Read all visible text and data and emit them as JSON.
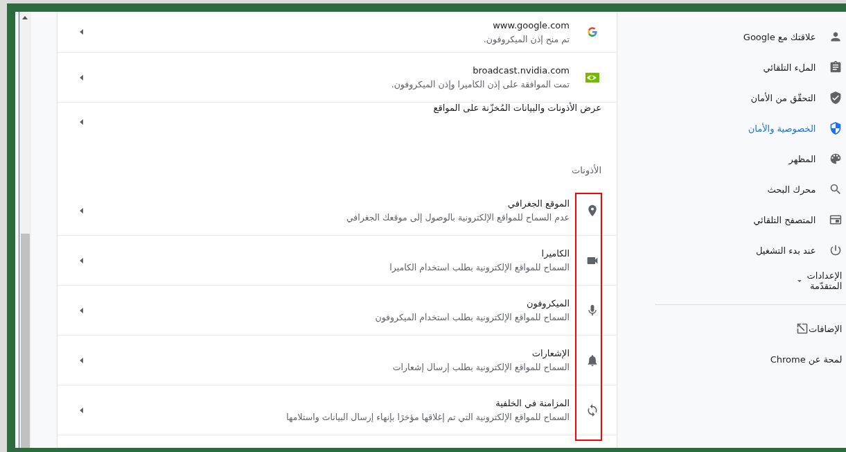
{
  "sites": [
    {
      "domain": "www.google.com",
      "status": "تم منح إذن الميكروفون.",
      "kind": "google"
    },
    {
      "domain": "broadcast.nvidia.com",
      "status": "تمت الموافقة على إذن الكاميرا وإذن الميكروفون.",
      "kind": "nvidia"
    }
  ],
  "view_all_link": "عرض الأذونات والبيانات المُخزّنة على المواقع",
  "permissions_heading": "الأذونات",
  "permissions": [
    {
      "title": "الموقع الجغرافي",
      "description": "عدم السماح للمواقع الإلكترونية بالوصول إلى موقعك الجغرافي",
      "kind": "location"
    },
    {
      "title": "الكاميرا",
      "description": "السماح للمواقع الإلكترونية بطلب استخدام الكاميرا",
      "kind": "camera"
    },
    {
      "title": "الميكروفون",
      "description": "السماح للمواقع الإلكترونية بطلب استخدام الميكروفون",
      "kind": "mic"
    },
    {
      "title": "الإشعارات",
      "description": "السماح للمواقع الإلكترونية بطلب إرسال إشعارات",
      "kind": "bell"
    },
    {
      "title": "المزامنة في الخلفية",
      "description": "السماح للمواقع الإلكترونية التي تم إغلاقها مؤخرًا بإنهاء إرسال البيانات واستلامها",
      "kind": "sync"
    }
  ],
  "sidebar": {
    "items": [
      {
        "label": "علاقتك مع Google",
        "kind": "person",
        "selected": false
      },
      {
        "label": "الملء التلقائي",
        "kind": "clipboard",
        "selected": false
      },
      {
        "label": "التحقّق من الأمان",
        "kind": "shield-check",
        "selected": false
      },
      {
        "label": "الخصوصية والأمان",
        "kind": "shield",
        "selected": true
      },
      {
        "label": "المظهر",
        "kind": "palette",
        "selected": false
      },
      {
        "label": "محرك البحث",
        "kind": "search",
        "selected": false
      },
      {
        "label": "المتصفح التلقائي",
        "kind": "browser",
        "selected": false
      },
      {
        "label": "عند بدء التشغيل",
        "kind": "power",
        "selected": false
      }
    ],
    "advanced": {
      "label": "الإعدادات المتقدّمة",
      "expanded": false
    },
    "extensions": {
      "label": "الإضافات"
    },
    "about": {
      "label": "لمحة عن Chrome"
    }
  }
}
